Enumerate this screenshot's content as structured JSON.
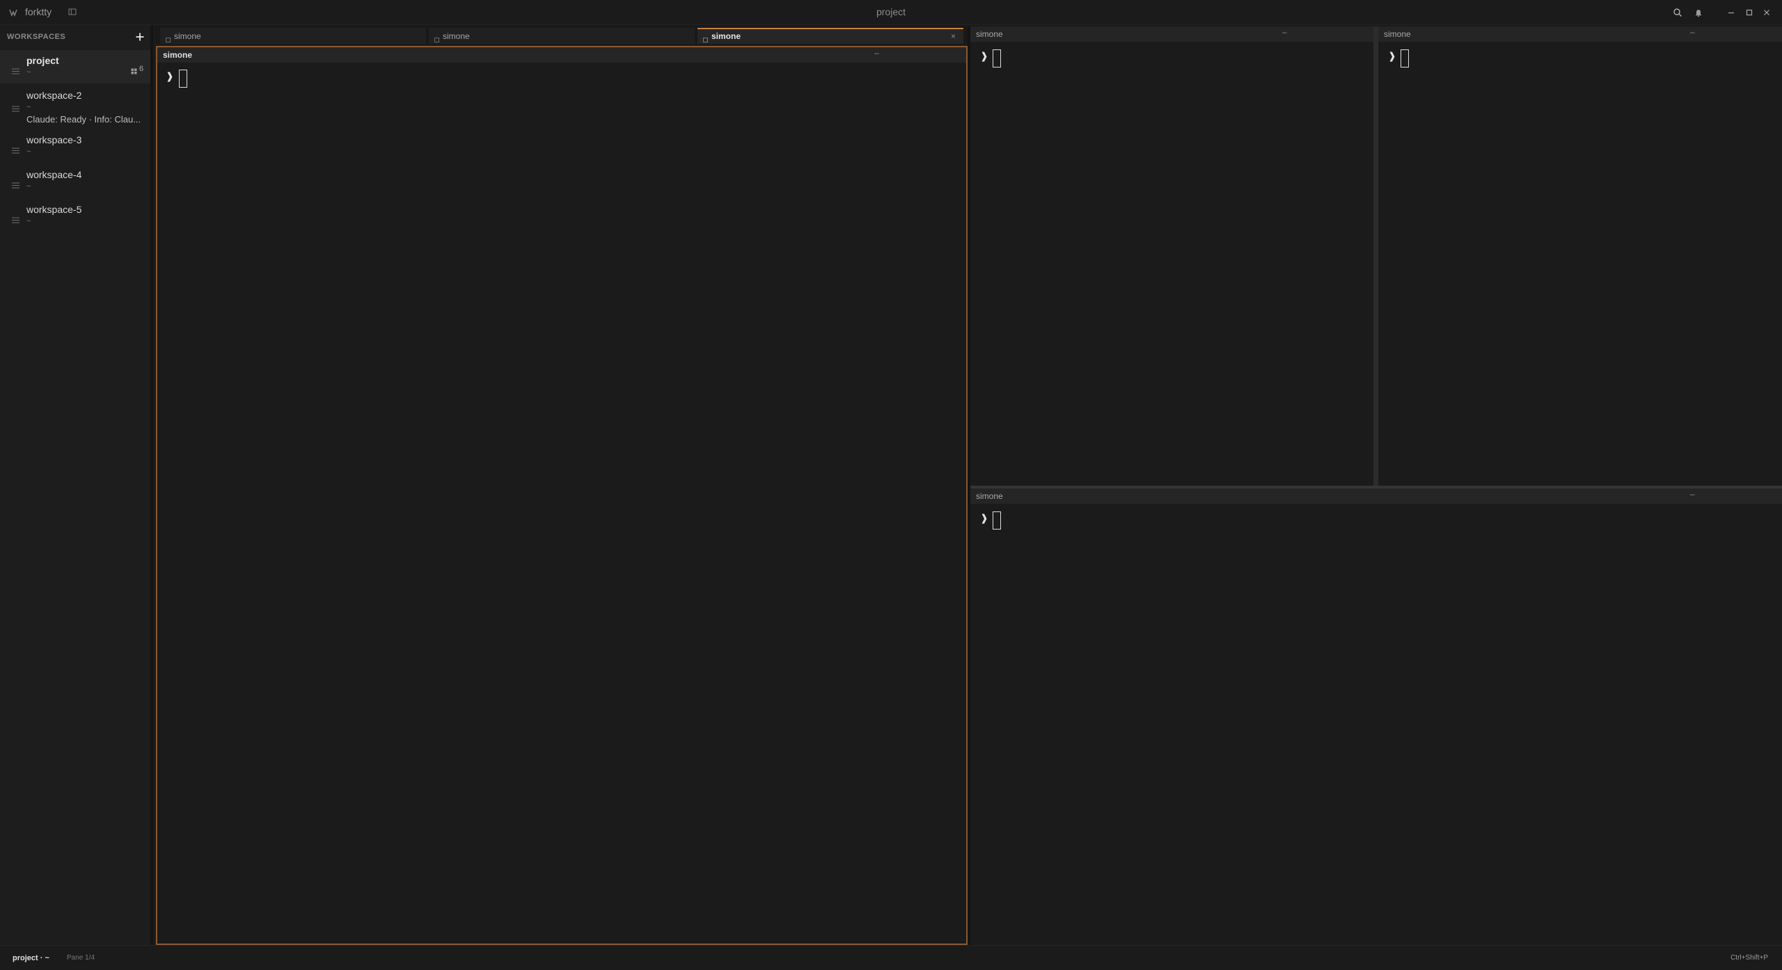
{
  "titlebar": {
    "app_name": "forktty",
    "window_title": "project"
  },
  "sidebar": {
    "header": "WORKSPACES",
    "add_label": "+",
    "workspaces": [
      {
        "name": "project",
        "subtitle": "~",
        "pane_count": "6",
        "active": true
      },
      {
        "name": "workspace-2",
        "subtitle": "~",
        "status": "Claude: Ready · Info: Clau..."
      },
      {
        "name": "workspace-3",
        "subtitle": "~"
      },
      {
        "name": "workspace-4",
        "subtitle": "~"
      },
      {
        "name": "workspace-5",
        "subtitle": "~"
      }
    ]
  },
  "tabs": [
    {
      "label": "simone",
      "active": false
    },
    {
      "label": "simone",
      "active": false
    },
    {
      "label": "simone",
      "active": true,
      "close": "×"
    }
  ],
  "panes": {
    "left": {
      "title": "simone",
      "minimize": "–",
      "prompt": "❱"
    },
    "top_middle": {
      "title": "simone",
      "minimize": "–",
      "prompt": "❱"
    },
    "top_right": {
      "title": "simone",
      "minimize": "–",
      "prompt": "❱"
    },
    "bottom": {
      "title": "simone",
      "minimize": "–",
      "prompt": "❱"
    }
  },
  "statusbar": {
    "workspace": "project · ~",
    "pane": "Pane 1/4",
    "shortcut": "Ctrl+Shift+P"
  },
  "colors": {
    "accent": "#c9803f",
    "active_pane_border": "#8a5a36",
    "background": "#1b1b1b"
  }
}
